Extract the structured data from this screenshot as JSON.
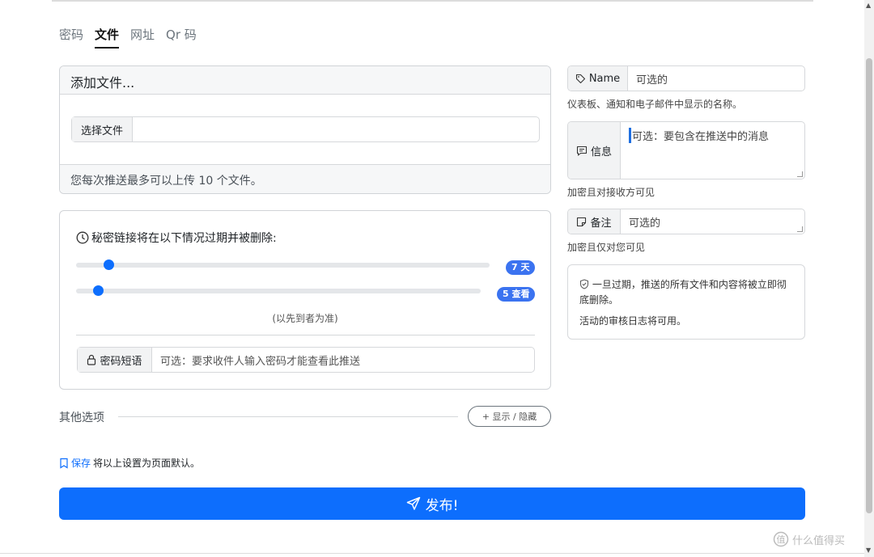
{
  "tabs": [
    {
      "label": "密码"
    },
    {
      "label": "文件"
    },
    {
      "label": "网址"
    },
    {
      "label": "Qr 码"
    }
  ],
  "file_card": {
    "title": "添加文件...",
    "choose_label": "选择文件",
    "footer": "您每次推送最多可以上传 10 个文件。"
  },
  "expire": {
    "title": "秘密链接将在以下情况过期并被删除:",
    "days_badge": "7 天",
    "days_value": 7,
    "views_badge": "5 查看",
    "views_value": 5,
    "hint": "(以先到者为准)",
    "password_label": "密码短语",
    "password_placeholder": "可选：要求收件人输入密码才能查看此推送"
  },
  "other": {
    "label": "其他选项",
    "toggle": "+ 显示 / 隐藏"
  },
  "save": {
    "link": "保存",
    "text": "将以上设置为页面默认。"
  },
  "publish": {
    "label": "发布!"
  },
  "name": {
    "label": "Name",
    "placeholder": "可选的",
    "help": "仪表板、通知和电子邮件中显示的名称。"
  },
  "message": {
    "label": "信息",
    "placeholder": "可选：要包含在推送中的消息",
    "help": "加密且对接收方可见"
  },
  "note": {
    "label": "备注",
    "placeholder": "可选的",
    "help": "加密且仅对您可见"
  },
  "notice": {
    "line1": "一旦过期，推送的所有文件和内容将被立即彻底删除。",
    "line2": "活动的审核日志将可用。"
  },
  "watermark": "什么值得买",
  "colors": {
    "primary": "#0d6efd",
    "badge": "#3b73f0"
  }
}
